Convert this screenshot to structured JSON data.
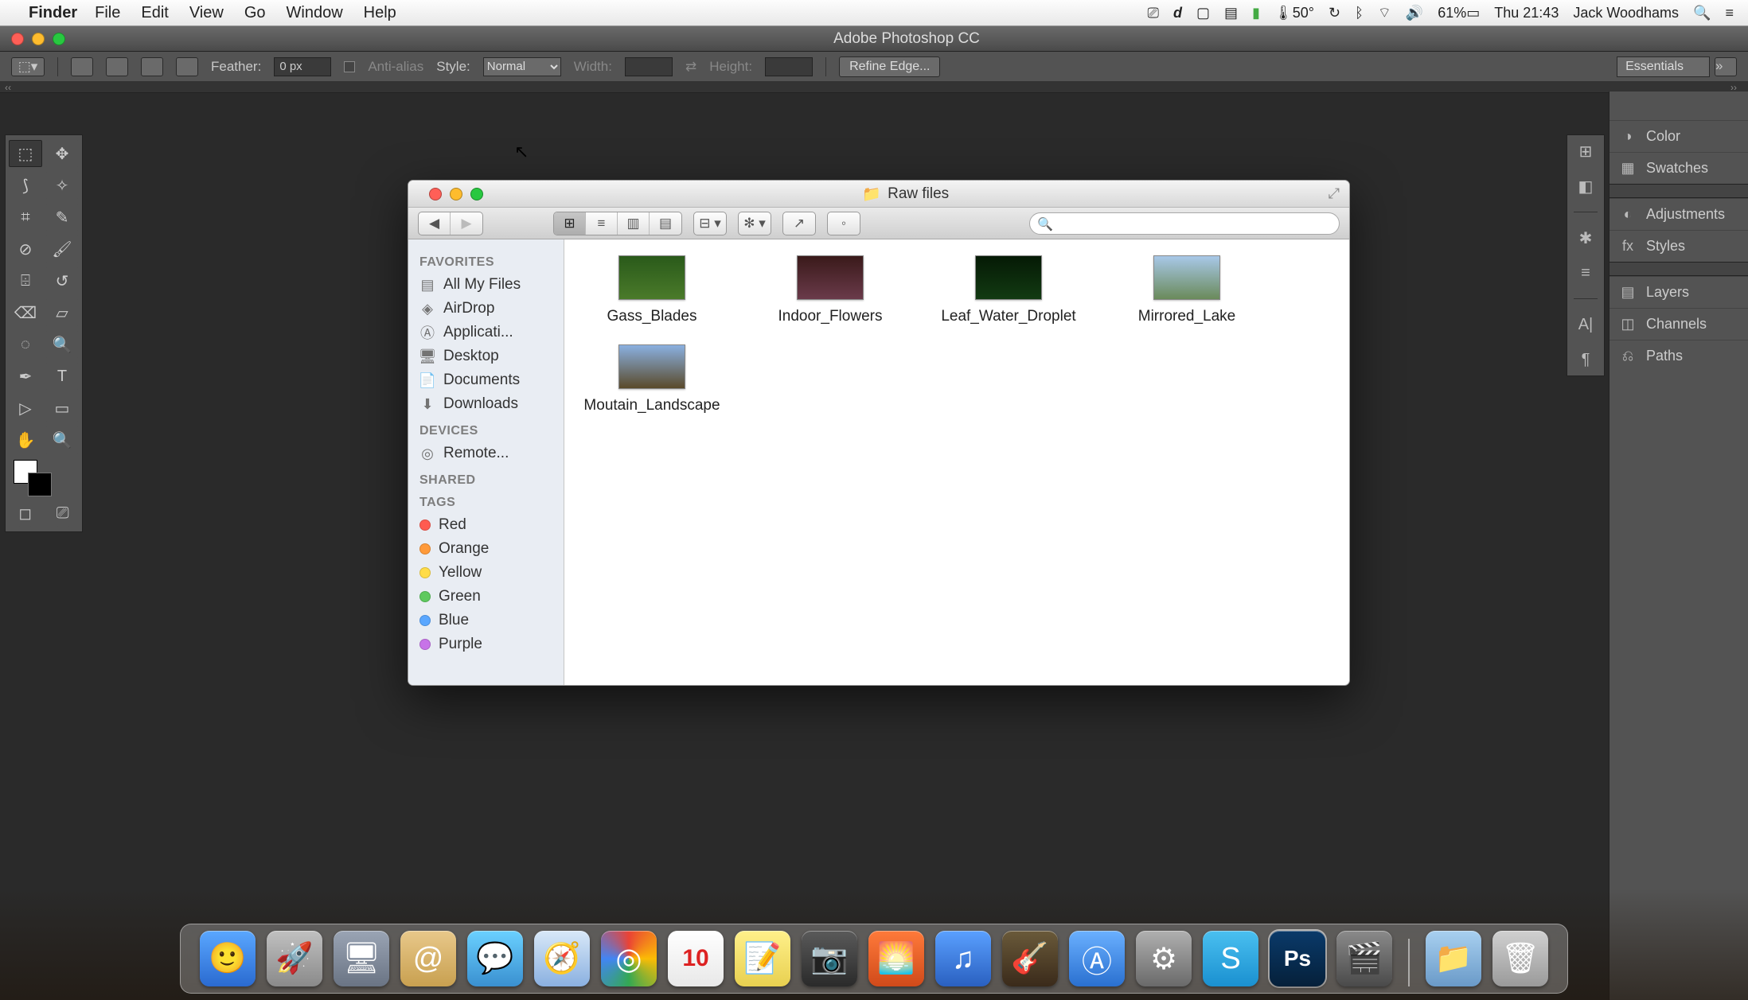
{
  "menubar": {
    "active_app": "Finder",
    "items": [
      "File",
      "Edit",
      "View",
      "Go",
      "Window",
      "Help"
    ],
    "status": {
      "temp": "50°",
      "battery": "61%",
      "datetime": "Thu 21:43",
      "user": "Jack Woodhams"
    }
  },
  "photoshop": {
    "title": "Adobe Photoshop CC",
    "options": {
      "feather_label": "Feather:",
      "feather_value": "0 px",
      "antialias_label": "Anti-alias",
      "style_label": "Style:",
      "style_value": "Normal",
      "width_label": "Width:",
      "height_label": "Height:",
      "refine_label": "Refine Edge...",
      "workspace": "Essentials"
    },
    "panels": [
      "Color",
      "Swatches",
      "Adjustments",
      "Styles",
      "Layers",
      "Channels",
      "Paths"
    ]
  },
  "finder": {
    "title": "Raw files",
    "sidebar": {
      "favorites_hdr": "FAVORITES",
      "favorites": [
        "All My Files",
        "AirDrop",
        "Applicati...",
        "Desktop",
        "Documents",
        "Downloads"
      ],
      "devices_hdr": "DEVICES",
      "devices": [
        "Remote..."
      ],
      "shared_hdr": "SHARED",
      "tags_hdr": "TAGS",
      "tags": [
        {
          "label": "Red",
          "color": "#ff5b50"
        },
        {
          "label": "Orange",
          "color": "#ff9a3a"
        },
        {
          "label": "Yellow",
          "color": "#ffdc47"
        },
        {
          "label": "Green",
          "color": "#5ec95e"
        },
        {
          "label": "Blue",
          "color": "#5aa7ff"
        },
        {
          "label": "Purple",
          "color": "#c773e8"
        }
      ]
    },
    "files": [
      {
        "name": "Gass_Blades",
        "bg": "linear-gradient(#2a5a1a,#4a7a2a)"
      },
      {
        "name": "Indoor_Flowers",
        "bg": "linear-gradient(#3a1a1a,#6a3a4a)"
      },
      {
        "name": "Leaf_Water_Droplet",
        "bg": "linear-gradient(#051a05,#123a12)"
      },
      {
        "name": "Mirrored_Lake",
        "bg": "linear-gradient(#a8c8e8,#6a8a5a)"
      },
      {
        "name": "Moutain_Landscape",
        "bg": "linear-gradient(#8ab0e0,#5a4a2a)"
      }
    ],
    "search_placeholder": ""
  },
  "dock": {
    "apps": [
      {
        "name": "finder",
        "glyph": "🙂",
        "bg": "linear-gradient(#5aa7ff,#2a6ad0)"
      },
      {
        "name": "launchpad",
        "glyph": "🚀",
        "bg": "linear-gradient(#c0c0c0,#8a8a8a)"
      },
      {
        "name": "mission-control",
        "glyph": "🖥",
        "bg": "linear-gradient(#9aa4b4,#6a7484)"
      },
      {
        "name": "mail",
        "glyph": "@",
        "bg": "linear-gradient(#e8c88a,#c8a050)"
      },
      {
        "name": "messages",
        "glyph": "💬",
        "bg": "linear-gradient(#6ad0ff,#3a90d0)"
      },
      {
        "name": "safari",
        "glyph": "🧭",
        "bg": "linear-gradient(#d8e8f8,#8ab0e0)"
      },
      {
        "name": "chrome",
        "glyph": "◎",
        "bg": "conic-gradient(#ea4335,#fbbc05,#34a853,#4285f4,#ea4335)"
      },
      {
        "name": "calendar",
        "glyph": "10",
        "bg": "linear-gradient(#fff,#e8e8e8)"
      },
      {
        "name": "notes",
        "glyph": "📝",
        "bg": "linear-gradient(#fff08a,#e8d050)"
      },
      {
        "name": "photobooth",
        "glyph": "📷",
        "bg": "linear-gradient(#5a5a5a,#2a2a2a)"
      },
      {
        "name": "iphoto",
        "glyph": "🌅",
        "bg": "linear-gradient(#ff7a3a,#d04a1a)"
      },
      {
        "name": "itunes",
        "glyph": "♫",
        "bg": "linear-gradient(#5aa0ff,#2a60c0)"
      },
      {
        "name": "garageband",
        "glyph": "🎸",
        "bg": "linear-gradient(#6a5a3a,#3a2a1a)"
      },
      {
        "name": "appstore",
        "glyph": "Ⓐ",
        "bg": "linear-gradient(#6ab0ff,#2a70d0)"
      },
      {
        "name": "preferences",
        "glyph": "⚙",
        "bg": "linear-gradient(#b0b0b0,#6a6a6a)"
      },
      {
        "name": "skype",
        "glyph": "S",
        "bg": "linear-gradient(#4ac0f0,#1a90d0)"
      },
      {
        "name": "photoshop",
        "glyph": "Ps",
        "bg": "linear-gradient(#0a3a6a,#05203a)",
        "active": true
      },
      {
        "name": "imovie",
        "glyph": "🎬",
        "bg": "linear-gradient(#8a8a8a,#4a4a4a)"
      }
    ],
    "right": [
      {
        "name": "downloads",
        "glyph": "📁",
        "bg": "linear-gradient(#a8d0f0,#6a9ac8)"
      },
      {
        "name": "trash",
        "glyph": "🗑",
        "bg": "linear-gradient(#d0d0d0,#9a9a9a)"
      }
    ]
  },
  "calendar_day": "10"
}
